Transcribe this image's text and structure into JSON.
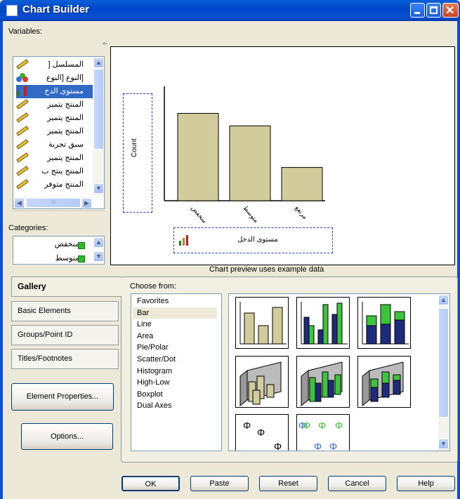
{
  "window": {
    "title": "Chart Builder"
  },
  "variables": {
    "label": "Variables:",
    "items": [
      {
        "label": "المسلسل [",
        "icon": "ruler-icon"
      },
      {
        "label": "[النوع [النوع",
        "icon": "nominal-icon"
      },
      {
        "label": "مستوى الدخ",
        "icon": "ordinal-icon",
        "selected": true
      },
      {
        "label": "المنتج يتميز",
        "icon": "ruler-icon"
      },
      {
        "label": "المنتج يتميز",
        "icon": "ruler-icon"
      },
      {
        "label": "المنتج يتميز",
        "icon": "ruler-icon"
      },
      {
        "label": "سبق تجربة",
        "icon": "ruler-icon"
      },
      {
        "label": "المنتج يتميز",
        "icon": "ruler-icon"
      },
      {
        "label": "المنتج ينتج ب",
        "icon": "ruler-icon"
      },
      {
        "label": "المنتج متوفر",
        "icon": "ruler-icon"
      }
    ],
    "hscroll_glyph": "III"
  },
  "categories": {
    "label": "Categories:",
    "items": [
      {
        "label": "منخفض"
      },
      {
        "label": "متوسط"
      }
    ]
  },
  "preview": {
    "y_drop_label": "Count",
    "x_drop_label": "مستوى الدخل",
    "footer": "Chart preview uses example data"
  },
  "chart_data": {
    "type": "bar",
    "categories": [
      "منخفض",
      "متوسط",
      "مرتفع"
    ],
    "values": [
      4.2,
      3.6,
      1.6
    ],
    "ylabel": "Count",
    "xlabel": "مستوى الدخل",
    "ylim": [
      0,
      5.5
    ],
    "bar_color": "#D2CB9C"
  },
  "tabs": [
    {
      "label": "Gallery",
      "active": true
    },
    {
      "label": "Basic Elements"
    },
    {
      "label": "Groups/Point ID"
    },
    {
      "label": "Titles/Footnotes"
    }
  ],
  "side_buttons": {
    "element_properties": "Element Properties...",
    "options": "Options..."
  },
  "gallery": {
    "choose_from_label": "Choose from:",
    "items": [
      "Favorites",
      "Bar",
      "Line",
      "Area",
      "Pie/Polar",
      "Scatter/Dot",
      "Histogram",
      "High-Low",
      "Boxplot",
      "Dual Axes"
    ],
    "selected": "Bar",
    "thumbnails": [
      {
        "name": "simple-bar-thumb"
      },
      {
        "name": "clustered-bar-thumb"
      },
      {
        "name": "stacked-bar-thumb"
      },
      {
        "name": "simple-3d-bar-thumb"
      },
      {
        "name": "clustered-3d-bar-thumb"
      },
      {
        "name": "stacked-3d-bar-thumb"
      },
      {
        "name": "simple-error-bar-thumb"
      },
      {
        "name": "clustered-error-bar-thumb"
      }
    ],
    "colors": {
      "tan": "#D2CB9C",
      "green": "#3CC43C",
      "navy": "#1E2A7A"
    }
  },
  "buttons": {
    "ok": "OK",
    "paste": "Paste",
    "reset": "Reset",
    "cancel": "Cancel",
    "help": "Help"
  }
}
